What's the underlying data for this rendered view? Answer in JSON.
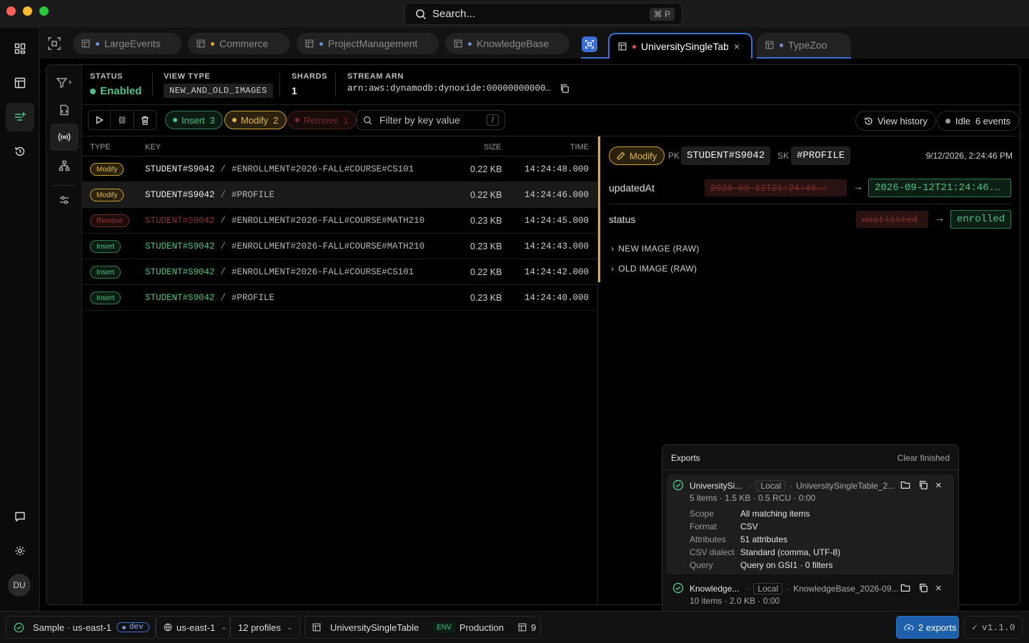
{
  "window": {
    "search_placeholder": "Search...",
    "search_shortcut": "⌘ P"
  },
  "rail": {
    "avatar_initials": "DU"
  },
  "tabs": [
    {
      "label": "LargeEvents",
      "dot_color": "#6f8fd8"
    },
    {
      "label": "Commerce",
      "dot_color": "#e0a640"
    },
    {
      "label": "ProjectManagement",
      "dot_color": "#6f8fd8"
    },
    {
      "label": "KnowledgeBase",
      "dot_color": "#6f8fd8"
    },
    {
      "label": "UniversitySingleTabl",
      "dot_color": "#e5484d",
      "active": true
    },
    {
      "label": "TypeZoo",
      "dot_color": "#6f8fd8"
    }
  ],
  "stream": {
    "status_label": "STATUS",
    "status_value": "Enabled",
    "view_type_label": "VIEW TYPE",
    "view_type_value": "NEW_AND_OLD_IMAGES",
    "shards_label": "SHARDS",
    "shards_value": "1",
    "arn_label": "STREAM ARN",
    "arn_value": "arn:aws:dynamodb:dynoxide:00000000000…"
  },
  "actions": {
    "insert_label": "Insert",
    "insert_count": "3",
    "modify_label": "Modify",
    "modify_count": "2",
    "remove_label": "Remove",
    "remove_count": "1",
    "filter_placeholder": "Filter by key value",
    "filter_shortcut": "/",
    "view_history": "View history",
    "idle_label": "Idle",
    "events_label": "6 events"
  },
  "table": {
    "headers": {
      "type": "TYPE",
      "key": "KEY",
      "size": "SIZE",
      "time": "TIME"
    },
    "rows": [
      {
        "type": "Modify",
        "pk": "STUDENT#S9042",
        "sep": "/",
        "sk": "#ENROLLMENT#2026-FALL#COURSE#CS101",
        "size": "0.22 KB",
        "time": "14:24:48.000"
      },
      {
        "type": "Modify",
        "pk": "STUDENT#S9042",
        "sep": "/",
        "sk": "#PROFILE",
        "size": "0.22 KB",
        "time": "14:24:46.000",
        "selected": true
      },
      {
        "type": "Remove",
        "pk": "STUDENT#S9042",
        "sep": "/",
        "sk": "#ENROLLMENT#2026-FALL#COURSE#MATH210",
        "size": "0.23 KB",
        "time": "14:24:45.000"
      },
      {
        "type": "Insert",
        "pk": "STUDENT#S9042",
        "sep": "/",
        "sk": "#ENROLLMENT#2026-FALL#COURSE#MATH210",
        "size": "0.23 KB",
        "time": "14:24:43.000"
      },
      {
        "type": "Insert",
        "pk": "STUDENT#S9042",
        "sep": "/",
        "sk": "#ENROLLMENT#2026-FALL#COURSE#CS101",
        "size": "0.22 KB",
        "time": "14:24:42.000"
      },
      {
        "type": "Insert",
        "pk": "STUDENT#S9042",
        "sep": "/",
        "sk": "#PROFILE",
        "size": "0.23 KB",
        "time": "14:24:40.000"
      }
    ]
  },
  "detail": {
    "event_type": "Modify",
    "pk_label": "PK",
    "pk_value": "STUDENT#S9042",
    "sk_label": "SK",
    "sk_value": "#PROFILE",
    "timestamp": "9/12/2026, 2:24:46 PM",
    "changes": [
      {
        "field": "updatedAt",
        "old": "2026-09-12T21:24:40.…",
        "new": "2026-09-12T21:24:46.…"
      },
      {
        "field": "status",
        "old": "waitlisted",
        "new": "enrolled"
      }
    ],
    "new_image_label": "NEW IMAGE (RAW)",
    "old_image_label": "OLD IMAGE (RAW)"
  },
  "exports": {
    "title": "Exports",
    "clear_label": "Clear finished",
    "items": [
      {
        "name": "UniversitySi...",
        "sep": "·",
        "location": "Local",
        "file": "UniversitySingleTable_2...",
        "stats": "5 items · 1.5 KB · 0.5 RCU · 0:00",
        "details": [
          {
            "k": "Scope",
            "v": "All matching items"
          },
          {
            "k": "Format",
            "v": "CSV"
          },
          {
            "k": "Attributes",
            "v": "51 attributes"
          },
          {
            "k": "CSV dialect",
            "v": "Standard (comma, UTF-8)"
          },
          {
            "k": "Query",
            "v": "Query on GSI1 · 0 filters"
          }
        ]
      },
      {
        "name": "Knowledge...",
        "sep": "·",
        "location": "Local",
        "file": "KnowledgeBase_2026-09...",
        "stats": "10 items · 2.0 KB · 0:00"
      }
    ]
  },
  "statusbar": {
    "connection": "Sample · us-east-1",
    "env_tag": "dev",
    "region": "us-east-1",
    "profiles": "12 profiles",
    "table_name": "UniversitySingleTable",
    "env_label": "ENV",
    "env_value": "Production",
    "table_count": "9",
    "exports_button": "2 exports",
    "version": "v1.1.0"
  },
  "colors": {
    "accent": "#3b6fd4",
    "green": "#4dc282",
    "amber": "#e0a640",
    "red": "#e5484d"
  }
}
